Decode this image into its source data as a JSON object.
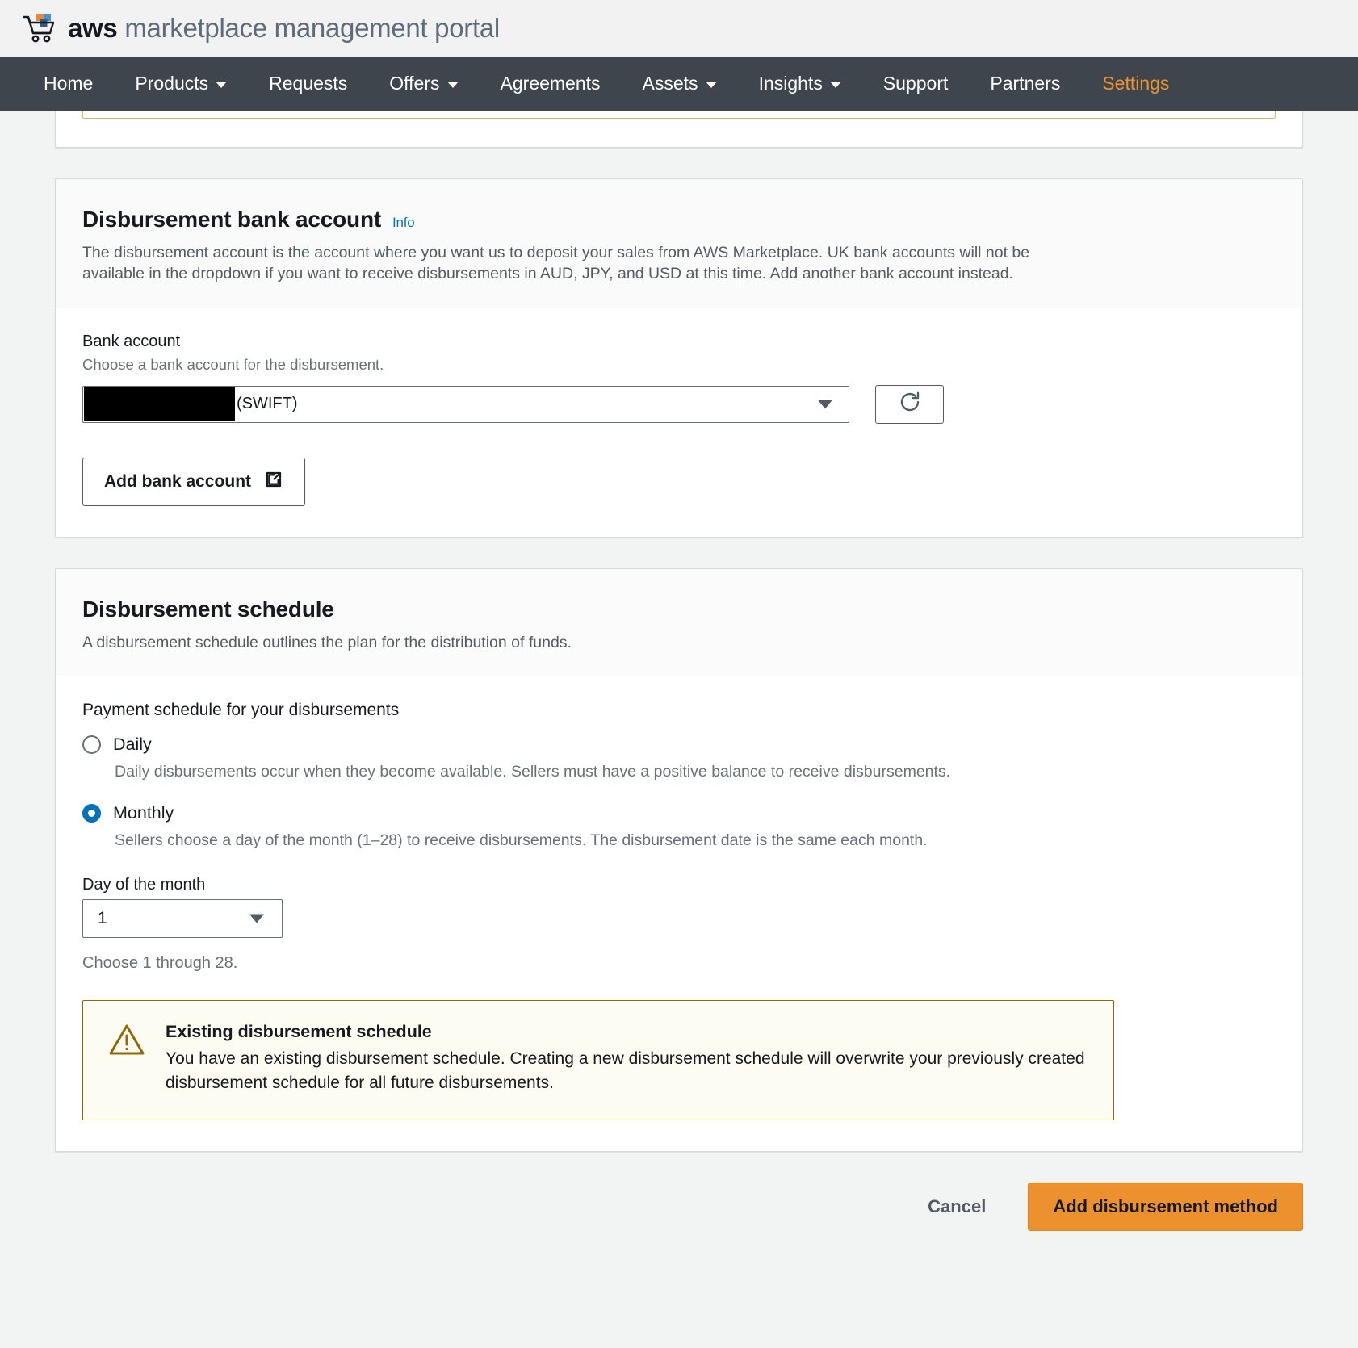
{
  "brand": {
    "logo_icon": "aws-marketplace-cart-icon",
    "name_bold": "aws",
    "name_rest": " marketplace management portal"
  },
  "nav": {
    "items": [
      {
        "label": "Home",
        "has_caret": false,
        "active": false
      },
      {
        "label": "Products",
        "has_caret": true,
        "active": false
      },
      {
        "label": "Requests",
        "has_caret": false,
        "active": false
      },
      {
        "label": "Offers",
        "has_caret": true,
        "active": false
      },
      {
        "label": "Agreements",
        "has_caret": false,
        "active": false
      },
      {
        "label": "Assets",
        "has_caret": true,
        "active": false
      },
      {
        "label": "Insights",
        "has_caret": true,
        "active": false
      },
      {
        "label": "Support",
        "has_caret": false,
        "active": false
      },
      {
        "label": "Partners",
        "has_caret": false,
        "active": false
      },
      {
        "label": "Settings",
        "has_caret": false,
        "active": true
      }
    ],
    "active_color": "#ec912d",
    "background": "#3f454d"
  },
  "bank_card": {
    "title": "Disbursement bank account",
    "info_label": "Info",
    "description": "The disbursement account is the account where you want us to deposit your sales from AWS Marketplace. UK bank accounts will not be available in the dropdown if you want to receive disbursements in AUD, JPY, and USD at this time. Add another bank account instead.",
    "field_label": "Bank account",
    "field_hint": "Choose a bank account for the disbursement.",
    "selected_value": "(SWIFT)",
    "redacted": true,
    "refresh_icon": "refresh-icon",
    "add_button_label": "Add bank account",
    "add_button_icon": "external-link-icon"
  },
  "schedule_card": {
    "title": "Disbursement schedule",
    "description": "A disbursement schedule outlines the plan for the distribution of funds.",
    "group_label": "Payment schedule for your disbursements",
    "options": [
      {
        "label": "Daily",
        "description": "Daily disbursements occur when they become available. Sellers must have a positive balance to receive disbursements.",
        "selected": false
      },
      {
        "label": "Monthly",
        "description": "Sellers choose a day of the month (1–28) to receive disbursements. The disbursement date is the same each month.",
        "selected": true
      }
    ],
    "day_label": "Day of the month",
    "day_value": "1",
    "day_hint": "Choose 1 through 28.",
    "alert": {
      "icon": "warning-triangle-icon",
      "title": "Existing disbursement schedule",
      "text": "You have an existing disbursement schedule. Creating a new disbursement schedule will overwrite your previously created disbursement schedule for all future disbursements.",
      "border_color": "#906806",
      "background": "#fdfcf2"
    }
  },
  "footer": {
    "cancel_label": "Cancel",
    "submit_label": "Add disbursement method",
    "submit_color": "#ec912d"
  }
}
